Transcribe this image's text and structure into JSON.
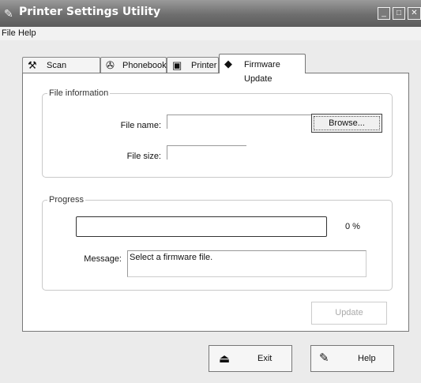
{
  "window": {
    "title": "Printer Settings Utility",
    "minimize_glyph": "_",
    "maximize_glyph": "□",
    "close_glyph": "✕"
  },
  "menu": [
    "File",
    "Help"
  ],
  "tabs": [
    {
      "label": "Scan Settings",
      "icon": "scanner-icon"
    },
    {
      "label": "Phonebook",
      "icon": "phonebook-icon"
    },
    {
      "label": "Printer",
      "icon": "printer-icon"
    },
    {
      "label": "Firmware Update",
      "icon": "firmware-chip-icon",
      "active": true
    }
  ],
  "file_info": {
    "legend": "File information",
    "file_name_label": "File name:",
    "file_name_value": "",
    "browse_label": "Browse...",
    "file_size_label": "File size:",
    "file_size_value": ""
  },
  "progress": {
    "legend": "Progress",
    "percent_text": "0 %",
    "fraction": 0,
    "message_label": "Message:",
    "message_value": "Select a firmware file."
  },
  "update_label": "Update",
  "exit_label": "Exit",
  "help_label": "Help"
}
